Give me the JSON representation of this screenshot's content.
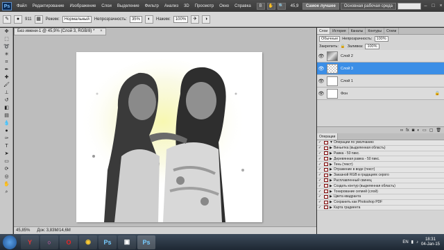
{
  "app": {
    "logo": "Ps",
    "menu": [
      "Файл",
      "Редактирование",
      "Изображение",
      "Слои",
      "Выделение",
      "Фильтр",
      "Анализ",
      "3D",
      "Просмотр",
      "Окно",
      "Справка"
    ],
    "zoom": "45,9",
    "workspace_buttons": [
      "Самое лучшее",
      "Основная рабочая среда"
    ]
  },
  "options": {
    "brush_size": "911",
    "mode_label": "Режим:",
    "mode_value": "Нормальный",
    "opacity_label": "Непрозрачность:",
    "opacity_value": "35%",
    "pressure_label": "Нажим:",
    "pressure_value": "100%"
  },
  "document": {
    "tab_title": "Без имени-1 @ 45,9% (Слой 3, RGB/8) *",
    "close": "×",
    "status_zoom": "45,85%",
    "status_doc": "Док: 3,83M/14,6M"
  },
  "layers_panel": {
    "tabs": [
      "Слои",
      "История",
      "Каналы",
      "Контуры",
      "Стили"
    ],
    "blend_mode": "Обычные",
    "opacity_label": "Непрозрачность:",
    "opacity_value": "100%",
    "lock_label": "Закрепить:",
    "fill_label": "Заливка:",
    "fill_value": "100%",
    "layers": [
      {
        "name": "Слой 2",
        "selected": false
      },
      {
        "name": "Слой 3",
        "selected": true
      },
      {
        "name": "Слой 1",
        "selected": false
      },
      {
        "name": "Фон",
        "selected": false
      }
    ]
  },
  "operations_panel": {
    "tab": "Операции",
    "items": [
      "Операции по умолчанию",
      "Виньетка (выделенная область)",
      "Рамка - 50 пикс.",
      "Деревянная рамка - 50 пикс.",
      "Тень (текст)",
      "Отражение в воде (текст)",
      "Заказной RGB в градациях серого",
      "Расплавленный свинец",
      "Создать контур (выделенная область)",
      "Тонирование сепией (слой)",
      "Цвета квадранта",
      "Сохранить как Photoshop PDF",
      "Карта градиента"
    ]
  },
  "taskbar": {
    "icons": [
      "Y",
      "○",
      "O",
      "◉",
      "Ps",
      "▣",
      "Ps"
    ],
    "lang": "EN",
    "time": "18:31",
    "date": "04-Jan-15"
  }
}
